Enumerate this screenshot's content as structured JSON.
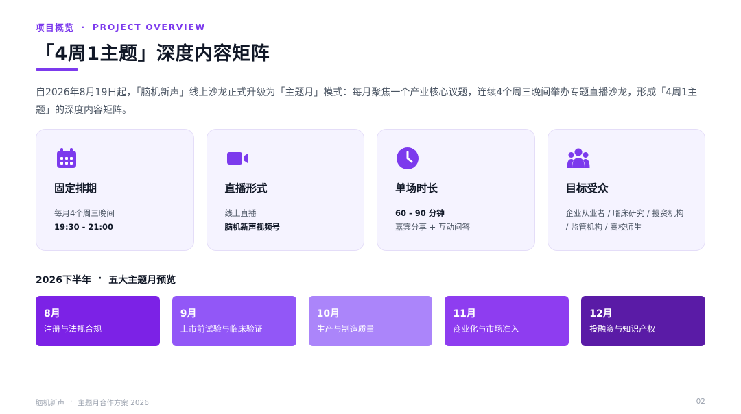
{
  "header": {
    "eyebrow_cn": "项目概览",
    "eyebrow_sep": "·",
    "eyebrow_en": "PROJECT OVERVIEW",
    "title": "「4周1主题」深度内容矩阵",
    "intro": "自2026年8月19日起，「脑机新声」线上沙龙正式升级为「主题月」模式：每月聚焦一个产业核心议题，连续4个周三晚间举办专题直播沙龙，形成「4周1主题」的深度内容矩阵。"
  },
  "cards": [
    {
      "icon": "calendar-icon",
      "title": "固定排期",
      "line1": "每月4个周三晚间",
      "line2": "19:30 - 21:00"
    },
    {
      "icon": "video-camera-icon",
      "title": "直播形式",
      "line1": "线上直播",
      "line2": "脑机新声视频号"
    },
    {
      "icon": "clock-icon",
      "title": "单场时长",
      "line1": "60 - 90 分钟",
      "line2": "嘉宾分享 + 互动问答"
    },
    {
      "icon": "audience-icon",
      "title": "目标受众",
      "line1": "企业从业者 / 临床研究 / 投资机构",
      "line2": "/ 监管机构 / 高校师生"
    }
  ],
  "section": {
    "left": "2026下半年",
    "sep": "·",
    "right": "五大主题月预览"
  },
  "months": [
    {
      "month": "8月",
      "topic": "注册与法规合规",
      "color": "#7c22e6"
    },
    {
      "month": "9月",
      "topic": "上市前试验与临床验证",
      "color": "#9257f7"
    },
    {
      "month": "10月",
      "topic": "生产与制造质量",
      "color": "#ab85fa"
    },
    {
      "month": "11月",
      "topic": "商业化与市场准入",
      "color": "#8e3df0"
    },
    {
      "month": "12月",
      "topic": "投融资与知识产权",
      "color": "#5a1ba6"
    }
  ],
  "footer": {
    "brand": "脑机新声",
    "sep": "·",
    "doc": "主题月合作方案 2026",
    "page": "02"
  },
  "colors": {
    "accent": "#7c3aed",
    "card_bg": "#f5f3ff"
  }
}
